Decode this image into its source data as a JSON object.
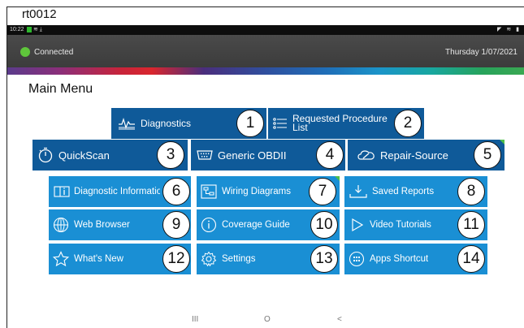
{
  "document_label": "rt0012",
  "system_bar": {
    "time": "10:22"
  },
  "status": {
    "connection": "Connected",
    "date": "Thursday 1/07/2021"
  },
  "menu_title": "Main Menu",
  "tiles": {
    "diagnostics": {
      "label": "Diagnostics",
      "badge": "1"
    },
    "requested_procedure": {
      "label_line1": "Requested Procedure",
      "label_line2": "List",
      "badge": "2"
    },
    "quickscan": {
      "label": "QuickScan",
      "badge": "3"
    },
    "generic_obdii": {
      "label": "Generic OBDII",
      "badge": "4"
    },
    "repair_source": {
      "label": "Repair-Source",
      "badge": "5"
    },
    "diagnostic_info": {
      "label": "Diagnostic Information",
      "badge": "6"
    },
    "wiring_diagrams": {
      "label": "Wiring Diagrams",
      "badge": "7"
    },
    "saved_reports": {
      "label": "Saved Reports",
      "badge": "8"
    },
    "web_browser": {
      "label": "Web Browser",
      "badge": "9"
    },
    "coverage_guide": {
      "label": "Coverage Guide",
      "badge": "10"
    },
    "video_tutorials": {
      "label": "Video Tutorials",
      "badge": "11"
    },
    "whats_new": {
      "label": "What's New",
      "badge": "12"
    },
    "settings": {
      "label": "Settings",
      "badge": "13"
    },
    "apps_shortcut": {
      "label": "Apps Shortcut",
      "badge": "14"
    }
  },
  "nav_bar": {
    "recents": "III",
    "home": "O",
    "back": "<"
  },
  "colors": {
    "tile_dark": "#0f5a99",
    "tile_light": "#1a8fd4",
    "connected": "#5fc63b",
    "status_bg": "#3c3c3c"
  }
}
